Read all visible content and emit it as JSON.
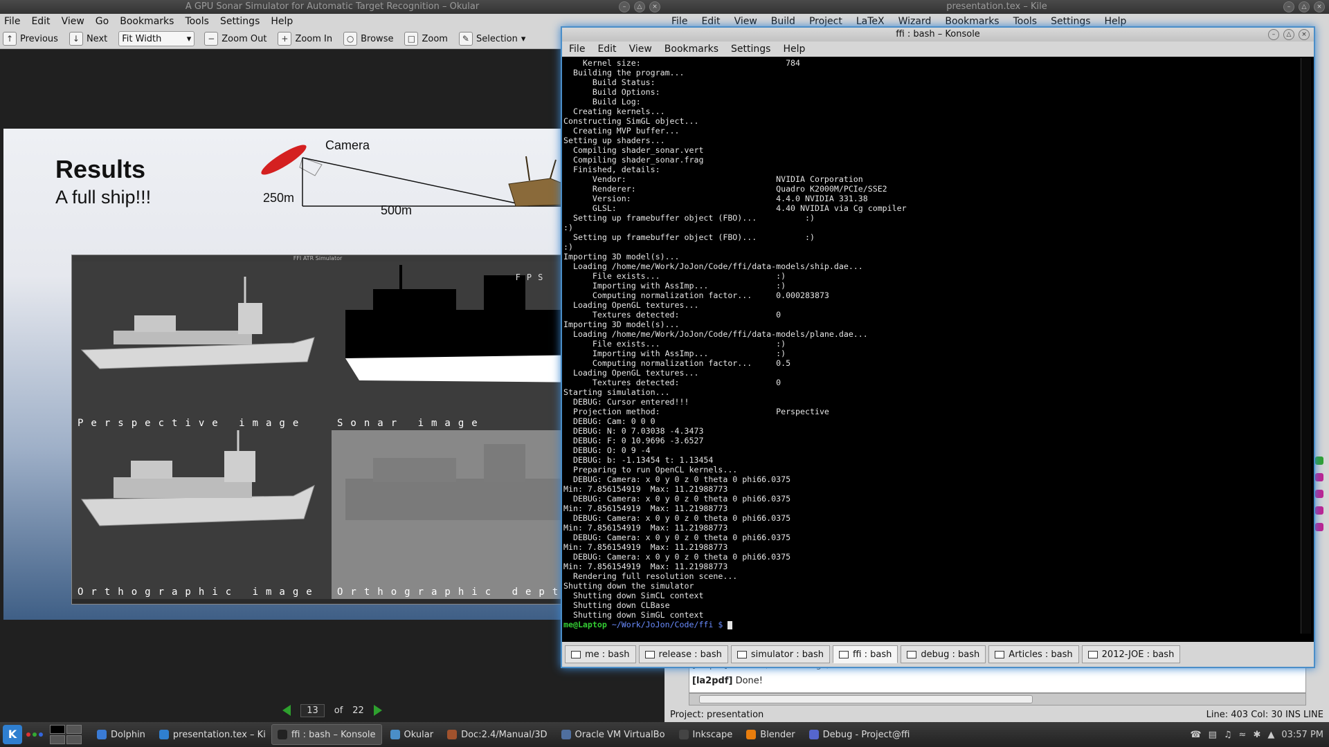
{
  "okular": {
    "title": "A GPU Sonar Simulator for Automatic Target Recognition – Okular",
    "menu": [
      "File",
      "Edit",
      "View",
      "Go",
      "Bookmarks",
      "Tools",
      "Settings",
      "Help"
    ],
    "toolbar": {
      "previous": "Previous",
      "next": "Next",
      "zoom_mode": "Fit Width",
      "zoom_out": "Zoom Out",
      "zoom_in": "Zoom In",
      "browse": "Browse",
      "zoom": "Zoom",
      "selection": "Selection"
    },
    "slide": {
      "title": "Results",
      "subtitle": "A full ship!!!",
      "camera_label": "Camera",
      "height_label": "250m",
      "distance_label": "500m",
      "sim_title": "FFI ATR Simulator",
      "fps": "FPS 57",
      "panels": [
        "Perspective image",
        "Sonar image",
        "Orthographic image",
        "Orthographic depth"
      ]
    },
    "pager": {
      "current": "13",
      "of": "of",
      "total": "22"
    }
  },
  "kile": {
    "title": "presentation.tex – Kile",
    "menu": [
      "File",
      "Edit",
      "View",
      "Build",
      "Project",
      "LaTeX",
      "Wizard",
      "Bookmarks",
      "Tools",
      "Settings",
      "Help"
    ],
    "log_partial": "[la2pdf] 0 errors, 12 warnings, 0 badboxes",
    "log_tag": "[la2pdf]",
    "log_done": "Done!",
    "project": "Project: presentation",
    "position": "Line: 403 Col: 30",
    "mode": "INS",
    "selmode": "LINE"
  },
  "konsole": {
    "title": "ffi : bash – Konsole",
    "menu": [
      "File",
      "Edit",
      "View",
      "Bookmarks",
      "Settings",
      "Help"
    ],
    "lines": [
      "    Kernel size:                              784",
      "  Building the program...",
      "      Build Status:",
      "      Build Options:",
      "      Build Log:",
      "",
      "  Creating kernels...",
      "Constructing SimGL object...",
      "  Creating MVP buffer...",
      "Setting up shaders...",
      "  Compiling shader_sonar.vert",
      "  Compiling shader_sonar.frag",
      "  Finished, details:",
      "      Vendor:                               NVIDIA Corporation",
      "      Renderer:                             Quadro K2000M/PCIe/SSE2",
      "      Version:                              4.4.0 NVIDIA 331.38",
      "      GLSL:                                 4.40 NVIDIA via Cg compiler",
      "  Setting up framebuffer object (FBO)...          :)",
      ":)",
      "  Setting up framebuffer object (FBO)...          :)",
      ":)",
      "Importing 3D model(s)...",
      "  Loading /home/me/Work/JoJon/Code/ffi/data-models/ship.dae...",
      "      File exists...                        :)",
      "      Importing with AssImp...              :)",
      "      Computing normalization factor...     0.000283873",
      "  Loading OpenGL textures...",
      "      Textures detected:                    0",
      "Importing 3D model(s)...",
      "  Loading /home/me/Work/JoJon/Code/ffi/data-models/plane.dae...",
      "      File exists...                        :)",
      "      Importing with AssImp...              :)",
      "      Computing normalization factor...     0.5",
      "  Loading OpenGL textures...",
      "      Textures detected:                    0",
      "Starting simulation...",
      "  DEBUG: Cursor entered!!!",
      "  Projection method:                        Perspective",
      "  DEBUG: Cam: 0 0 0",
      "  DEBUG: N: 0 7.03038 -4.3473",
      "  DEBUG: F: 0 10.9696 -3.6527",
      "  DEBUG: O: 0 9 -4",
      "  DEBUG: b: -1.13454 t: 1.13454",
      "  Preparing to run OpenCL kernels...",
      "  DEBUG: Camera: x 0 y 0 z 0 theta 0 phi66.0375",
      "Min: 7.856154919  Max: 11.21988773",
      "  DEBUG: Camera: x 0 y 0 z 0 theta 0 phi66.0375",
      "Min: 7.856154919  Max: 11.21988773",
      "  DEBUG: Camera: x 0 y 0 z 0 theta 0 phi66.0375",
      "Min: 7.856154919  Max: 11.21988773",
      "  DEBUG: Camera: x 0 y 0 z 0 theta 0 phi66.0375",
      "Min: 7.856154919  Max: 11.21988773",
      "  DEBUG: Camera: x 0 y 0 z 0 theta 0 phi66.0375",
      "Min: 7.856154919  Max: 11.21988773",
      "  Rendering full resolution scene...",
      "Shutting down the simulator",
      "  Shutting down SimCL context",
      "  Shutting down CLBase",
      "  Shutting down SimGL context"
    ],
    "prompt_user": "me@Laptop",
    "prompt_path": "~/Work/JoJon/Code/ffi $",
    "tabs": [
      "me : bash",
      "release : bash",
      "simulator : bash",
      "ffi : bash",
      "debug : bash",
      "Articles : bash",
      "2012-JOE : bash"
    ],
    "active_tab_index": 3
  },
  "taskbar": {
    "tasks": [
      "Dolphin",
      "presentation.tex – Ki",
      "ffi : bash – Konsole",
      "Okular",
      "Doc:2.4/Manual/3D",
      "Oracle VM VirtualBo",
      "Inkscape",
      "Blender",
      "Debug - Project@ffi"
    ],
    "clock": "03:57 PM"
  },
  "colors": {
    "accent": "#4a8ec8",
    "prompt_user": "#33cc33",
    "prompt_path": "#6a8cff",
    "pager_arrow": "#2ea02e"
  }
}
